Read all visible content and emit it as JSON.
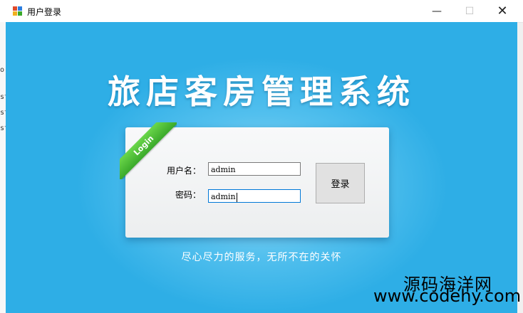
{
  "window": {
    "title": "用户登录",
    "minimize": "—",
    "maximize": "☐",
    "close": "✕"
  },
  "background_window": {
    "fragments": [
      "o",
      "st",
      "st",
      "st"
    ]
  },
  "app": {
    "title": "旅店客房管理系统",
    "ribbon": "Login",
    "slogan": "尽心尽力的服务，无所不在的关怀"
  },
  "form": {
    "username_label": "用户名：",
    "username_value": "admin",
    "password_label": "密码：",
    "password_value": "admin",
    "login_button": "登录"
  },
  "watermark": {
    "line1": "源码海洋网",
    "line2": "www.codehy.com"
  },
  "colors": {
    "background": "#2eaee6",
    "ribbon": "#4cbf34",
    "focus_border": "#0078d7"
  }
}
